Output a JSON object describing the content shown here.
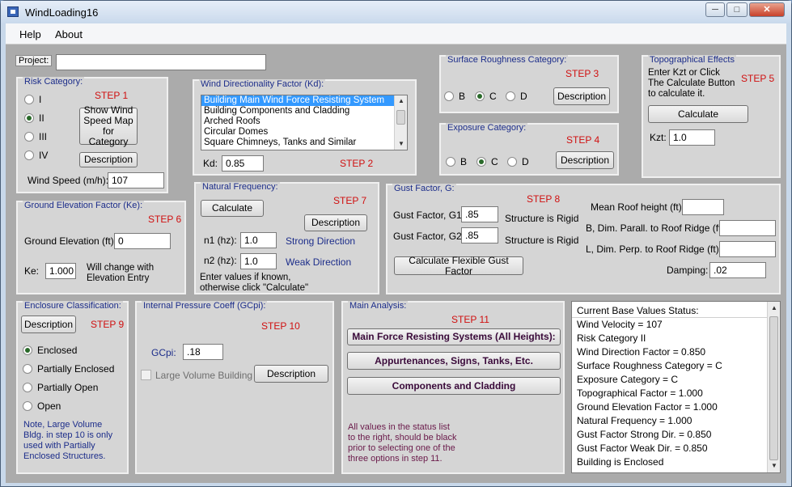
{
  "window": {
    "title": "WindLoading16"
  },
  "menu": [
    "Help",
    "About"
  ],
  "project": {
    "label": "Project:",
    "value": ""
  },
  "risk": {
    "title": "Risk Category:",
    "step": "STEP 1",
    "options": [
      "I",
      "II",
      "III",
      "IV"
    ],
    "selected": "II",
    "map_button": "Show Wind Speed Map for Category",
    "desc_button": "Description",
    "speed_label": "Wind Speed (m/h):",
    "speed_value": "107"
  },
  "kd": {
    "title": "Wind Directionality Factor (Kd):",
    "items": [
      "Building Main Wind Force Resisting System",
      "Building Components and Cladding",
      "Arched Roofs",
      "Circular Domes",
      "Square Chimneys, Tanks and Similar"
    ],
    "selected_index": 0,
    "label": "Kd:",
    "value": "0.85",
    "step": "STEP 2"
  },
  "roughness": {
    "title": "Surface Roughness Category:",
    "step": "STEP 3",
    "options": [
      "B",
      "C",
      "D"
    ],
    "selected": "C",
    "desc_button": "Description"
  },
  "exposure": {
    "title": "Exposure Category:",
    "step": "STEP 4",
    "options": [
      "B",
      "C",
      "D"
    ],
    "selected": "C",
    "desc_button": "Description"
  },
  "topo": {
    "title": "Topographical Effects",
    "instructions": "Enter Kzt or Click The Calculate Button to calculate it.",
    "step": "STEP 5",
    "calc_button": "Calculate",
    "label": "Kzt:",
    "value": "1.0"
  },
  "ke": {
    "title": "Ground Elevation Factor (Ke):",
    "step": "STEP 6",
    "elev_label": "Ground Elevation (ft):",
    "elev_value": "0",
    "ke_label": "Ke:",
    "ke_value": "1.000",
    "note": "Will change with Elevation Entry"
  },
  "nat": {
    "title": "Natural Frequency:",
    "step": "STEP 7",
    "calc_button": "Calculate",
    "desc_button": "Description",
    "n1_label": "n1 (hz):",
    "n1_value": "1.0",
    "n1_dir": "Strong Direction",
    "n2_label": "n2 (hz):",
    "n2_value": "1.0",
    "n2_dir": "Weak Direction",
    "note": "Enter values if known, otherwise click \"Calculate\""
  },
  "gust": {
    "title": "Gust Factor, G:",
    "step": "STEP 8",
    "g1_label": "Gust Factor, G1:",
    "g1_value": ".85",
    "g1_status": "Structure is Rigid",
    "g2_label": "Gust Factor, G2:",
    "g2_value": ".85",
    "g2_status": "Structure is Rigid",
    "flex_button": "Calculate Flexible Gust Factor",
    "roof_label": "Mean Roof height (ft):",
    "roof_value": "",
    "b_label": "B, Dim. Parall. to Roof Ridge (ft):",
    "b_value": "",
    "l_label": "L, Dim. Perp. to Roof Ridge (ft):",
    "l_value": "",
    "damping_label": "Damping:",
    "damping_value": ".02"
  },
  "enclosure": {
    "title": "Enclosure Classification:",
    "desc_button": "Description",
    "step": "STEP 9",
    "options": [
      "Enclosed",
      "Partially Enclosed",
      "Partially Open",
      "Open"
    ],
    "selected": "Enclosed",
    "note": "Note, Large Volume Bldg. in step 10 is only used with Partially Enclosed Structures."
  },
  "gcpi": {
    "title": "Internal Pressure Coeff (GCpi):",
    "step": "STEP 10",
    "label": "GCpi:",
    "value": ".18",
    "checkbox_label": "Large Volume Building",
    "desc_button": "Description"
  },
  "main": {
    "title": "Main Analysis:",
    "step": "STEP 11",
    "buttons": [
      "Main Force Resisting Systems (All Heights):",
      "Appurtenances, Signs, Tanks, Etc.",
      "Components and Cladding"
    ],
    "note": "All values in the status list to the right, should be black prior to selecting one of the three options in step 11."
  },
  "status": {
    "items": [
      "Current Base Values Status:",
      "Wind Velocity = 107",
      "Risk Category II",
      "Wind Direction Factor = 0.850",
      "Surface Roughness Category = C",
      "Exposure Category = C",
      "Topographical Factor =  1.000",
      "Ground Elevation Factor =  1.000",
      "Natural Frequency =  1.000",
      "Gust Factor Strong Dir. =  0.850",
      "Gust Factor Weak Dir. =  0.850",
      "Building is Enclosed"
    ]
  }
}
